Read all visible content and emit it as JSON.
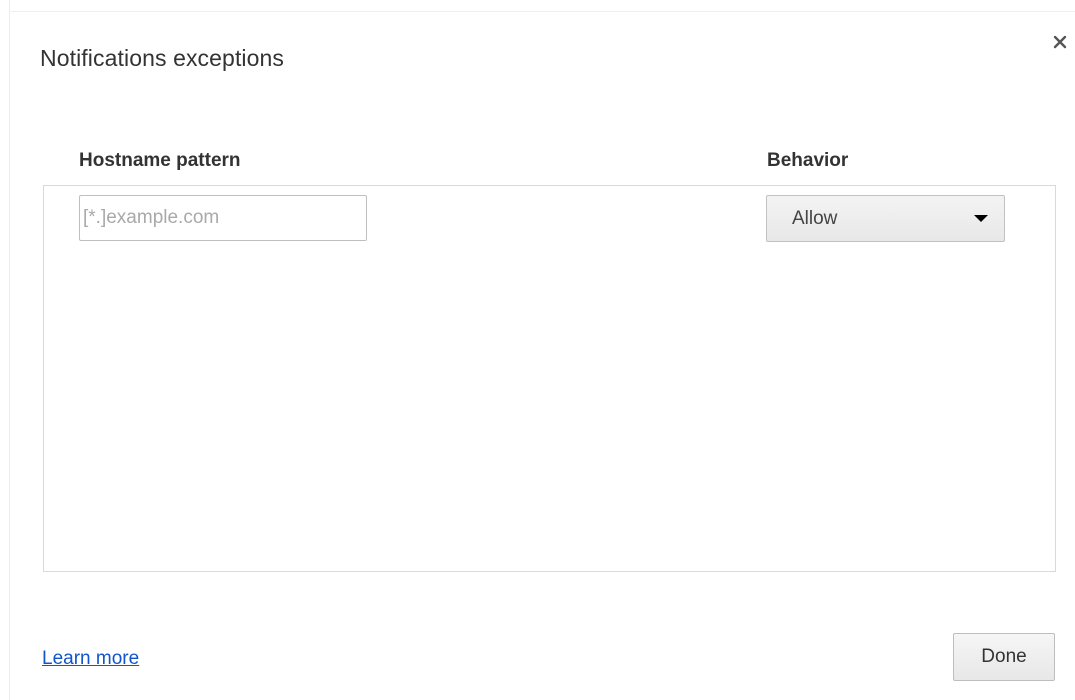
{
  "dialog": {
    "title": "Notifications exceptions",
    "close_icon": "close-icon"
  },
  "table": {
    "columns": [
      {
        "label": "Hostname pattern"
      },
      {
        "label": "Behavior"
      }
    ],
    "new_row": {
      "hostname_value": "",
      "hostname_placeholder": "[*.]example.com",
      "behavior_selected": "Allow"
    }
  },
  "footer": {
    "learn_more_label": "Learn more",
    "done_label": "Done"
  },
  "colors": {
    "link": "#1155cc",
    "text": "#333333",
    "border": "#d9d9d9"
  }
}
